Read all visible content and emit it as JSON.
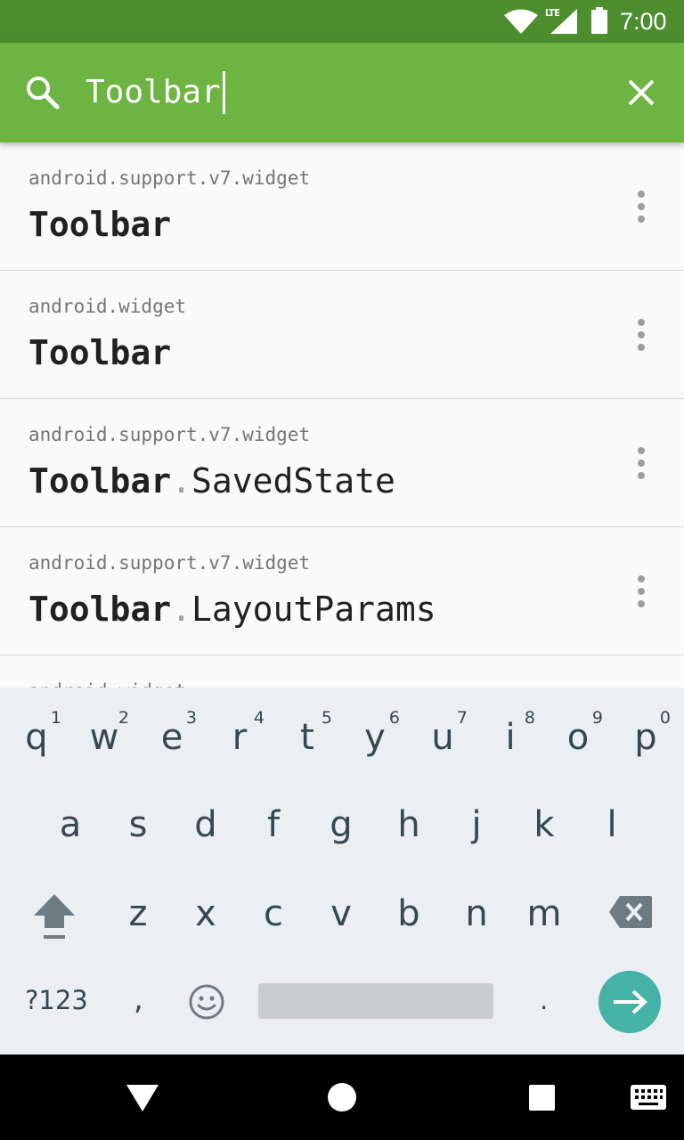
{
  "status_bar": {
    "network": "LTE",
    "time": "7:00"
  },
  "search": {
    "query": "Toolbar"
  },
  "results": [
    {
      "package": "android.support.v7.widget",
      "match": "Toolbar",
      "suffix_dot": "",
      "suffix": ""
    },
    {
      "package": "android.widget",
      "match": "Toolbar",
      "suffix_dot": "",
      "suffix": ""
    },
    {
      "package": "android.support.v7.widget",
      "match": "Toolbar",
      "suffix_dot": ".",
      "suffix": "SavedState"
    },
    {
      "package": "android.support.v7.widget",
      "match": "Toolbar",
      "suffix_dot": ".",
      "suffix": "LayoutParams"
    },
    {
      "package": "android.widget"
    }
  ],
  "keyboard": {
    "row1": [
      {
        "key": "q",
        "hint": "1"
      },
      {
        "key": "w",
        "hint": "2"
      },
      {
        "key": "e",
        "hint": "3"
      },
      {
        "key": "r",
        "hint": "4"
      },
      {
        "key": "t",
        "hint": "5"
      },
      {
        "key": "y",
        "hint": "6"
      },
      {
        "key": "u",
        "hint": "7"
      },
      {
        "key": "i",
        "hint": "8"
      },
      {
        "key": "o",
        "hint": "9"
      },
      {
        "key": "p",
        "hint": "0"
      }
    ],
    "row2": [
      "a",
      "s",
      "d",
      "f",
      "g",
      "h",
      "j",
      "k",
      "l"
    ],
    "row3": [
      "z",
      "x",
      "c",
      "v",
      "b",
      "n",
      "m"
    ],
    "symbols_label": "?123",
    "comma": ",",
    "period": "."
  }
}
